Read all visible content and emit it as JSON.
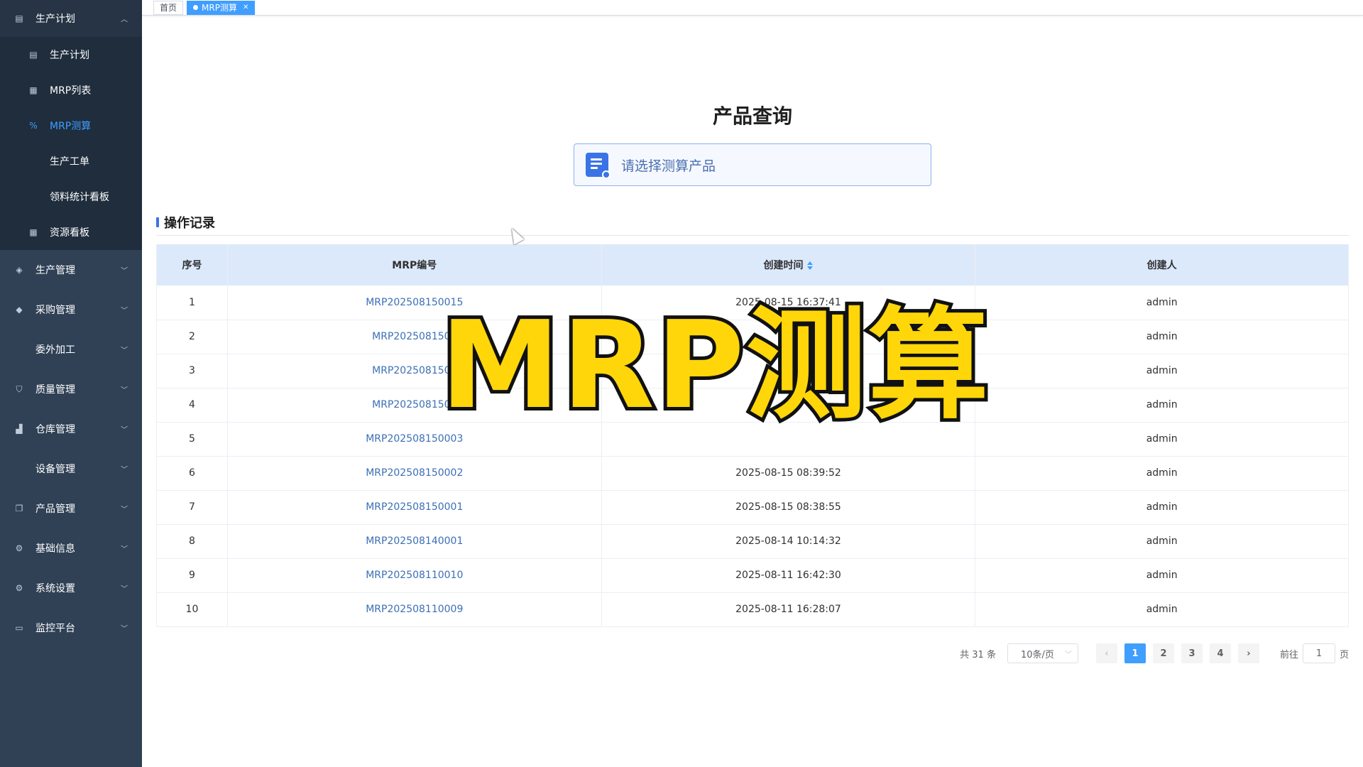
{
  "tags": [
    {
      "label": "首页",
      "active": false
    },
    {
      "label": "MRP测算",
      "active": true
    }
  ],
  "sidebar": {
    "open_group": {
      "label": "生产计划",
      "icon": "calendar-icon"
    },
    "sub_items": [
      {
        "label": "生产计划",
        "icon": "calendar-icon",
        "active": false
      },
      {
        "label": "MRP列表",
        "icon": "list-icon",
        "active": false
      },
      {
        "label": "MRP测算",
        "icon": "percent-icon",
        "active": true
      },
      {
        "label": "生产工单",
        "icon": "",
        "active": false
      },
      {
        "label": "领料统计看板",
        "icon": "",
        "active": false
      },
      {
        "label": "资源看板",
        "icon": "grid-icon",
        "active": false
      }
    ],
    "groups": [
      {
        "label": "生产管理",
        "icon": "cube-icon"
      },
      {
        "label": "采购管理",
        "icon": "basket-icon"
      },
      {
        "label": "委外加工",
        "icon": ""
      },
      {
        "label": "质量管理",
        "icon": "shield-icon"
      },
      {
        "label": "仓库管理",
        "icon": "blocks-icon"
      },
      {
        "label": "设备管理",
        "icon": ""
      },
      {
        "label": "产品管理",
        "icon": "copy-icon"
      },
      {
        "label": "基础信息",
        "icon": "gear-icon"
      },
      {
        "label": "系统设置",
        "icon": "gear-icon"
      },
      {
        "label": "监控平台",
        "icon": "monitor-icon"
      }
    ]
  },
  "main": {
    "title": "产品查询",
    "search_placeholder": "请选择测算产品",
    "section_title": "操作记录",
    "table": {
      "headers": [
        "序号",
        "MRP编号",
        "创建时间",
        "创建人"
      ],
      "rows": [
        {
          "idx": "1",
          "code": "MRP202508150015",
          "time": "2025-08-15 16:37:41",
          "user": "admin"
        },
        {
          "idx": "2",
          "code": "MRP2025081500",
          "time": "",
          "user": "admin"
        },
        {
          "idx": "3",
          "code": "MRP2025081500",
          "time": "",
          "user": "admin"
        },
        {
          "idx": "4",
          "code": "MRP2025081500",
          "time": "",
          "user": "admin"
        },
        {
          "idx": "5",
          "code": "MRP202508150003",
          "time": "",
          "user": "admin"
        },
        {
          "idx": "6",
          "code": "MRP202508150002",
          "time": "2025-08-15 08:39:52",
          "user": "admin"
        },
        {
          "idx": "7",
          "code": "MRP202508150001",
          "time": "2025-08-15 08:38:55",
          "user": "admin"
        },
        {
          "idx": "8",
          "code": "MRP202508140001",
          "time": "2025-08-14 10:14:32",
          "user": "admin"
        },
        {
          "idx": "9",
          "code": "MRP202508110010",
          "time": "2025-08-11 16:42:30",
          "user": "admin"
        },
        {
          "idx": "10",
          "code": "MRP202508110009",
          "time": "2025-08-11 16:28:07",
          "user": "admin"
        }
      ]
    },
    "pager": {
      "total": "共 31 条",
      "page_size": "10条/页",
      "pages": [
        "1",
        "2",
        "3",
        "4"
      ],
      "current": "1",
      "goto_prefix": "前往",
      "goto_value": "1",
      "goto_suffix": "页"
    }
  },
  "overlay_text": "MRP测算",
  "colors": {
    "accent": "#409eff",
    "sidebar_bg": "#304156",
    "header_bg": "#dce9fa",
    "overlay_fill": "#ffd60a"
  }
}
